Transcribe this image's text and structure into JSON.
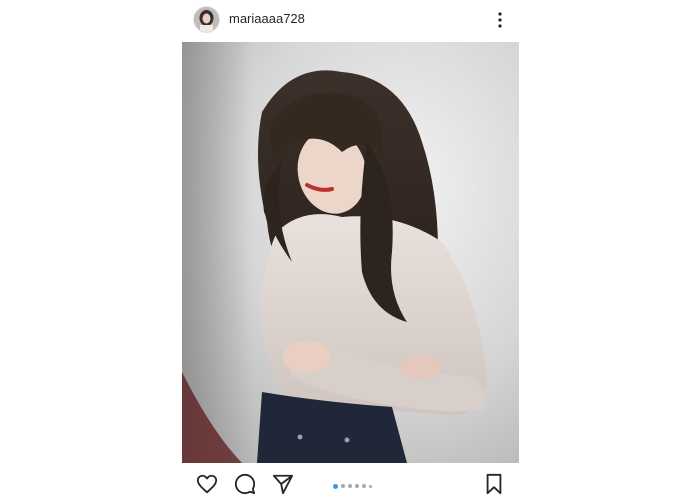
{
  "post": {
    "username": "mariaaaa728",
    "avatar_icon": "user-avatar",
    "more_icon": "more-vertical-icon",
    "photo_alt": "",
    "carousel": {
      "count": 6,
      "active_index": 0
    }
  },
  "actions": {
    "like_icon": "heart-icon",
    "comment_icon": "comment-icon",
    "share_icon": "send-icon",
    "save_icon": "bookmark-icon"
  },
  "colors": {
    "text": "#262626",
    "accent": "#3897f0",
    "dot_inactive": "#a8a8a8"
  }
}
